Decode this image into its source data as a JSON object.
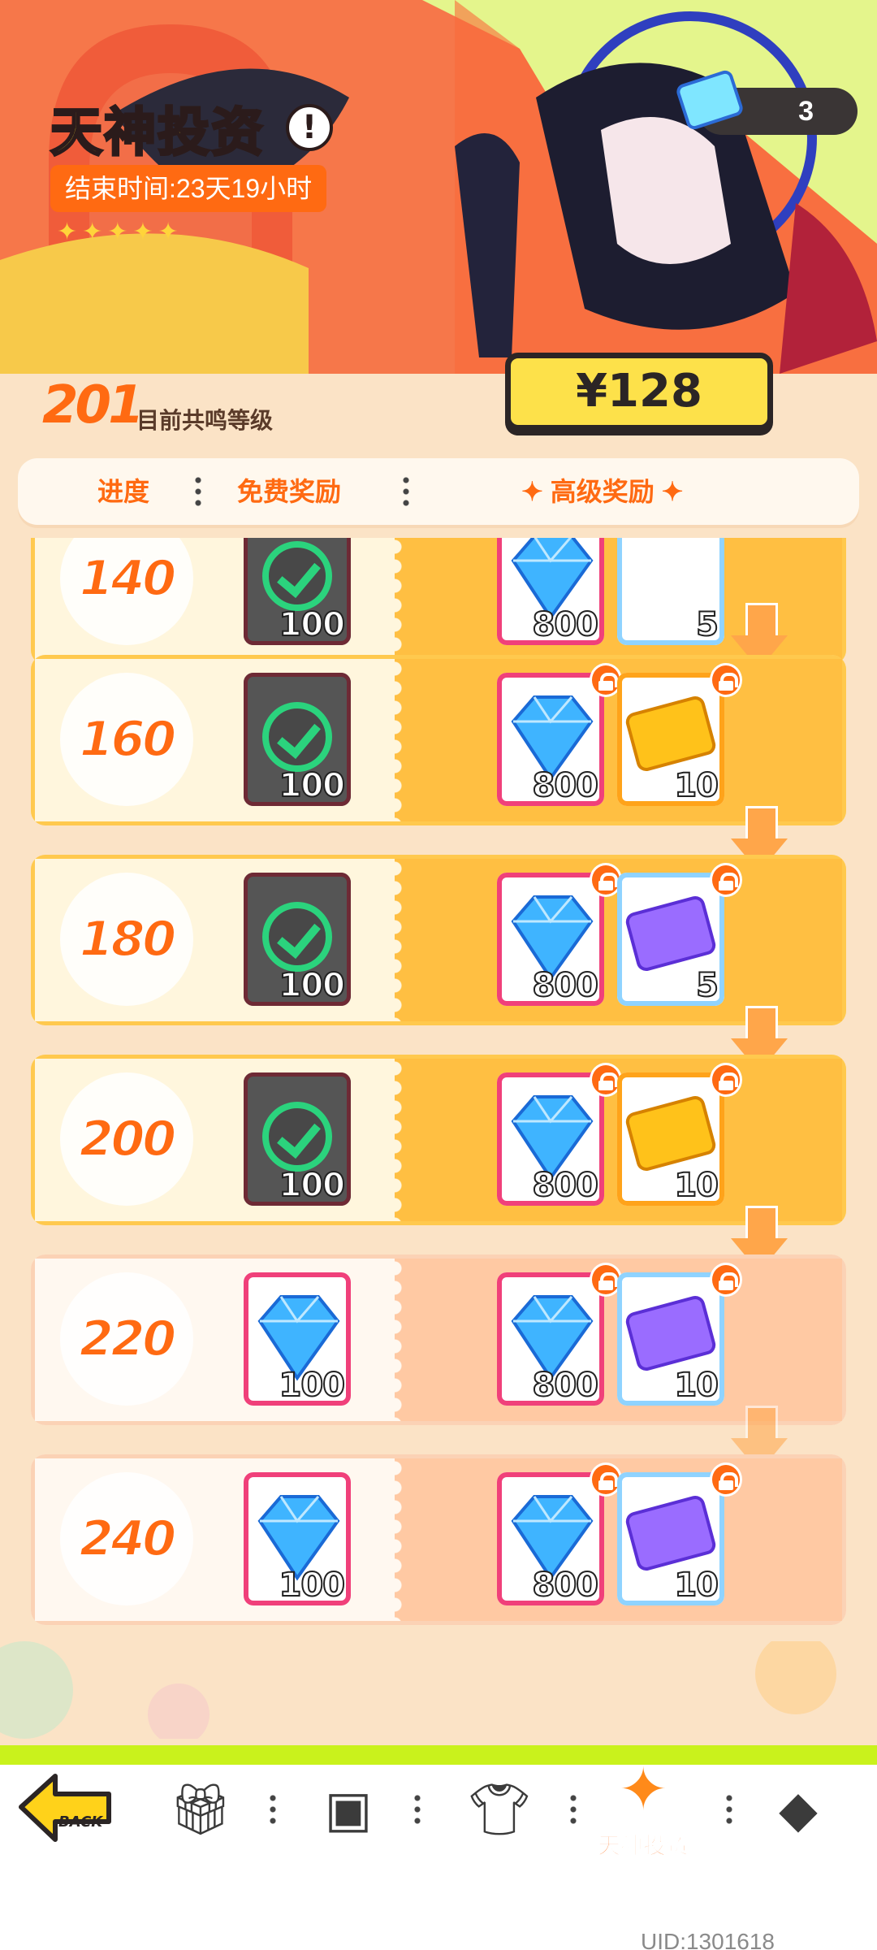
{
  "header": {
    "title": "天神投资",
    "end_time": "结束时间:23天19小时",
    "stars": "✦✦✦✦✦",
    "currency_count": "3",
    "price": "¥128"
  },
  "resonance": {
    "level": "201",
    "label": "目前共鸣等级"
  },
  "columns": {
    "progress": "进度",
    "free": "免费奖励",
    "premium": "高级奖励"
  },
  "rows": [
    {
      "level": "140",
      "free_qty": "100",
      "gem_qty": "800",
      "ticket_qty": "5"
    },
    {
      "level": "160",
      "free_qty": "100",
      "gem_qty": "800",
      "ticket_qty": "10"
    },
    {
      "level": "180",
      "free_qty": "100",
      "gem_qty": "800",
      "ticket_qty": "5"
    },
    {
      "level": "200",
      "free_qty": "100",
      "gem_qty": "800",
      "ticket_qty": "10"
    },
    {
      "level": "220",
      "free_qty": "100",
      "gem_qty": "800",
      "ticket_qty": "10"
    },
    {
      "level": "240",
      "free_qty": "100",
      "gem_qty": "800",
      "ticket_qty": "10"
    }
  ],
  "tabbar": {
    "back_label": "BACK",
    "active_label": "天神投资",
    "icons": [
      "back-arrow-icon",
      "gift-icon",
      "cards-icon",
      "shirt-icon",
      "sparkle-star-icon",
      "diamond-icon"
    ]
  },
  "uid": "UID:1301618",
  "colors": {
    "accent": "#ff6a12",
    "gold": "#ffbf42",
    "green_check": "#2bd37d",
    "lime": "#c9f21c"
  }
}
